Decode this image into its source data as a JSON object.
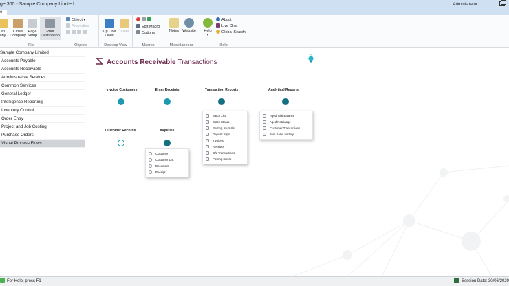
{
  "window": {
    "title": "ge 300 - Sample Company Limited",
    "user": "Administrator"
  },
  "ribbon": {
    "tab": "e",
    "file_group": {
      "label": "File",
      "buttons": [
        "en\nany",
        "Close\nCompany",
        "Page\nSetup",
        "Print\nDestination"
      ]
    },
    "objects_group": {
      "label": "Objects",
      "object": "Object",
      "properties": "Properties"
    },
    "desktop_group": {
      "label": "Desktop View",
      "up_one_level": "Up One\nLevel",
      "view": "View"
    },
    "macros_group": {
      "label": "Macros",
      "edit_macro": "Edit Macro",
      "options": "Options"
    },
    "misc_group": {
      "label": "Miscellaneous",
      "notes": "Notes",
      "website": "Website"
    },
    "help_group": {
      "label": "Help",
      "help": "Help",
      "about": "About",
      "live_chat": "Live Chat",
      "global_search": "Global Search"
    }
  },
  "sidebar": {
    "items": [
      {
        "label": "Sample Company Limited"
      },
      {
        "label": "Accounts Payable"
      },
      {
        "label": "Accounts Receivable"
      },
      {
        "label": "Administrative Services"
      },
      {
        "label": "Common Services"
      },
      {
        "label": "General Ledger"
      },
      {
        "label": "Intelligence Reporting"
      },
      {
        "label": "Inventory Control"
      },
      {
        "label": "Order Entry"
      },
      {
        "label": "Project and Job Costing"
      },
      {
        "label": "Purchase Orders"
      },
      {
        "label": "Visual Process Flows"
      }
    ],
    "active_index": 11
  },
  "flow": {
    "title_bold": "Accounts Receivable",
    "title_rest": "Transactions",
    "columns": {
      "invoice_customers": "Invoice Customers",
      "enter_receipts": "Enter Receipts",
      "transaction_reports": "Transaction Reports",
      "analytical_reports": "Analytical Reports",
      "customer_records": "Customer Records",
      "inquiries": "Inquiries"
    },
    "inquiries_menu": [
      "Customer",
      "Customer List",
      "Document",
      "Receipt"
    ],
    "transaction_reports_menu": [
      "Batch List",
      "Batch Status",
      "Posting Journals",
      "Deposit Slips",
      "Invoices",
      "Receipts",
      "G/L Transactions",
      "Posting Errors"
    ],
    "analytical_reports_menu": [
      "Aged Trial Balance",
      "Aged Retainage",
      "Customer Transactions",
      "Item Sales History"
    ]
  },
  "status": {
    "help": "For Help, press F1",
    "session": "Session Date: 30/06/2020"
  },
  "colors": {
    "accent": "#6e2a4e",
    "node": "#1e9ab0",
    "node_dark": "#127080"
  }
}
